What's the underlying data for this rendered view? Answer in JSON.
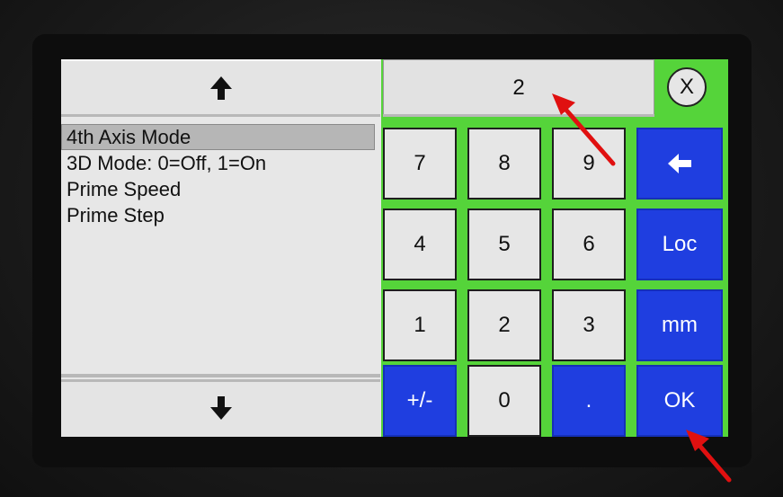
{
  "list_panel": {
    "scroll_up_icon": "arrow-up-icon",
    "scroll_down_icon": "arrow-down-icon",
    "items": [
      {
        "label": "4th Axis Mode",
        "selected": true
      },
      {
        "label": "3D Mode: 0=Off, 1=On",
        "selected": false
      },
      {
        "label": "Prime Speed",
        "selected": false
      },
      {
        "label": "Prime Step",
        "selected": false
      }
    ]
  },
  "keypad": {
    "display_value": "2",
    "close_label": "X",
    "keys": {
      "k7": "7",
      "k8": "8",
      "k9": "9",
      "backspace_icon": "arrow-left-icon",
      "k4": "4",
      "k5": "5",
      "k6": "6",
      "loc": "Loc",
      "k1": "1",
      "k2": "2",
      "k3": "3",
      "mm": "mm",
      "plusminus": "+/-",
      "k0": "0",
      "decimal": ".",
      "ok": "OK"
    }
  },
  "colors": {
    "keypad_background": "#55d43a",
    "blue_key": "#1f3ee0",
    "grey_key": "#e6e6e6",
    "annotation_arrow": "#e01010"
  }
}
